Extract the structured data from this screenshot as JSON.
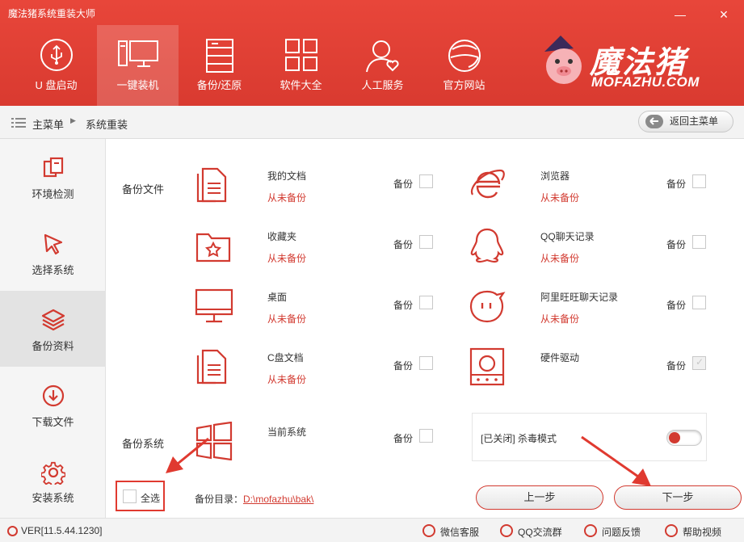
{
  "window": {
    "title": "魔法猪系统重装大师",
    "min": "—",
    "close": "×"
  },
  "nav": {
    "items": [
      {
        "label": "U 盘启动",
        "icon": "usb-icon"
      },
      {
        "label": "一键装机",
        "icon": "computer-icon",
        "active": true
      },
      {
        "label": "备份/还原",
        "icon": "server-icon"
      },
      {
        "label": "软件大全",
        "icon": "apps-grid-icon"
      },
      {
        "label": "人工服务",
        "icon": "user-heart-icon"
      },
      {
        "label": "官方网站",
        "icon": "globe-icon"
      }
    ]
  },
  "logo": {
    "cn": "魔法猪",
    "en": "MOFAZHU.COM"
  },
  "breadcrumb": {
    "home": "主菜单",
    "current": "系统重装",
    "back_button": "返回主菜单"
  },
  "sidebar": {
    "items": [
      {
        "label": "环境检测",
        "icon": "copy-icon"
      },
      {
        "label": "选择系统",
        "icon": "cursor-icon"
      },
      {
        "label": "备份资料",
        "icon": "layers-icon",
        "active": true
      },
      {
        "label": "下载文件",
        "icon": "download-icon"
      },
      {
        "label": "安装系统",
        "icon": "gear-icon"
      }
    ]
  },
  "backup_files": {
    "section_label": "备份文件",
    "backup_label": "备份",
    "left": [
      {
        "name": "我的文档",
        "status": "从未备份",
        "icon": "document-icon"
      },
      {
        "name": "收藏夹",
        "status": "从未备份",
        "icon": "favorites-folder-icon"
      },
      {
        "name": "桌面",
        "status": "从未备份",
        "icon": "monitor-icon"
      },
      {
        "name": "C盘文档",
        "status": "从未备份",
        "icon": "document-icon"
      }
    ],
    "right": [
      {
        "name": "浏览器",
        "status": "从未备份",
        "icon": "ie-browser-icon"
      },
      {
        "name": "QQ聊天记录",
        "status": "从未备份",
        "icon": "qq-icon"
      },
      {
        "name": "阿里旺旺聊天记录",
        "status": "从未备份",
        "icon": "wangwang-icon"
      },
      {
        "name": "硬件驱动",
        "status": "",
        "icon": "hardware-icon"
      }
    ]
  },
  "backup_system": {
    "section_label": "备份系统",
    "name": "当前系统",
    "backup_label": "备份",
    "icon": "windows-icon"
  },
  "antivirus": {
    "label": "[已关闭] 杀毒模式",
    "enabled": false
  },
  "bottom": {
    "select_all": "全选",
    "backup_dir_label": "备份目录：",
    "backup_dir_path": "D:\\mofazhu\\bak\\",
    "prev_button": "上一步",
    "next_button": "下一步"
  },
  "footer": {
    "version": "VER[11.5.44.1230]",
    "links": [
      "微信客服",
      "QQ交流群",
      "问题反馈",
      "帮助视频"
    ]
  },
  "colors": {
    "brand_red": "#d93a30",
    "accent": "#d23a30"
  }
}
